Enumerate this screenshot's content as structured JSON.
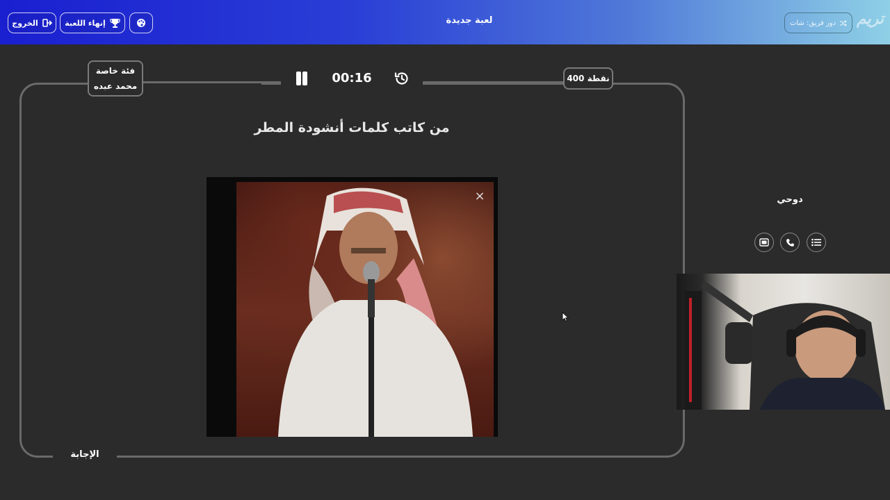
{
  "header": {
    "title": "لعبة جديدة",
    "exit_label": "الخروج",
    "end_game_label": "إنهاء اللعبة",
    "turn_label": "دور فريق: شات",
    "logo_text": "تريم"
  },
  "game": {
    "points_label": "400 نقطة",
    "category_line1": "فئة خاصة",
    "category_line2": "محمد عبده",
    "timer": "00:16",
    "question": "من كاتب كلمات أنشودة المطر",
    "answer_label": "الإجابة",
    "close_glyph": "×"
  },
  "side": {
    "team_name": "دوحي"
  },
  "icons": {
    "exit": "exit-icon",
    "trophy": "trophy-icon",
    "settings": "palette-icon",
    "shuffle": "shuffle-icon",
    "pause": "pause-icon",
    "history": "history-icon",
    "list": "list-icon",
    "phone": "phone-icon",
    "swap": "swap-image-icon"
  },
  "colors": {
    "background": "#2b2b2b",
    "frame": "#6a6a6a",
    "header_start": "#1a1fd0",
    "header_end": "#8fd0e6"
  }
}
